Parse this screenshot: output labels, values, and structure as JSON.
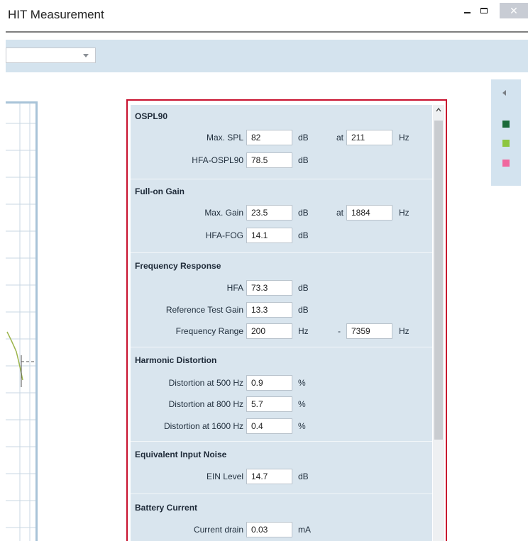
{
  "window": {
    "title": "HIT Measurement",
    "minimize_label": "",
    "maximize_label": "",
    "close_label": "✕"
  },
  "toolbar": {
    "combo_value": ""
  },
  "legend_colors": [
    "#1b6b3a",
    "#8dc63f",
    "#f0679e"
  ],
  "sections": {
    "ospl90": {
      "title": "OSPL90",
      "max_spl_label": "Max. SPL",
      "max_spl_value": "82",
      "max_spl_unit": "dB",
      "at_label": "at",
      "max_spl_freq": "211",
      "freq_unit": "Hz",
      "hfa_ospl90_label": "HFA-OSPL90",
      "hfa_ospl90_value": "78.5",
      "hfa_ospl90_unit": "dB"
    },
    "full_on_gain": {
      "title": "Full-on Gain",
      "max_gain_label": "Max. Gain",
      "max_gain_value": "23.5",
      "max_gain_unit": "dB",
      "at_label": "at",
      "max_gain_freq": "1884",
      "freq_unit": "Hz",
      "hfa_fog_label": "HFA-FOG",
      "hfa_fog_value": "14.1",
      "hfa_fog_unit": "dB"
    },
    "frequency_response": {
      "title": "Frequency Response",
      "hfa_label": "HFA",
      "hfa_value": "73.3",
      "hfa_unit": "dB",
      "rtg_label": "Reference Test Gain",
      "rtg_value": "13.3",
      "rtg_unit": "dB",
      "range_label": "Frequency Range",
      "range_low": "200",
      "range_low_unit": "Hz",
      "range_dash": "-",
      "range_high": "7359",
      "range_high_unit": "Hz"
    },
    "harmonic_distortion": {
      "title": "Harmonic Distortion",
      "d500_label": "Distortion at 500 Hz",
      "d500_value": "0.9",
      "d500_unit": "%",
      "d800_label": "Distortion at 800 Hz",
      "d800_value": "5.7",
      "d800_unit": "%",
      "d1600_label": "Distortion at 1600 Hz",
      "d1600_value": "0.4",
      "d1600_unit": "%"
    },
    "ein": {
      "title": "Equivalent Input Noise",
      "ein_label": "EIN Level",
      "ein_value": "14.7",
      "ein_unit": "dB"
    },
    "battery": {
      "title": "Battery Current",
      "drain_label": "Current drain",
      "drain_value": "0.03",
      "drain_unit": "mA"
    }
  }
}
